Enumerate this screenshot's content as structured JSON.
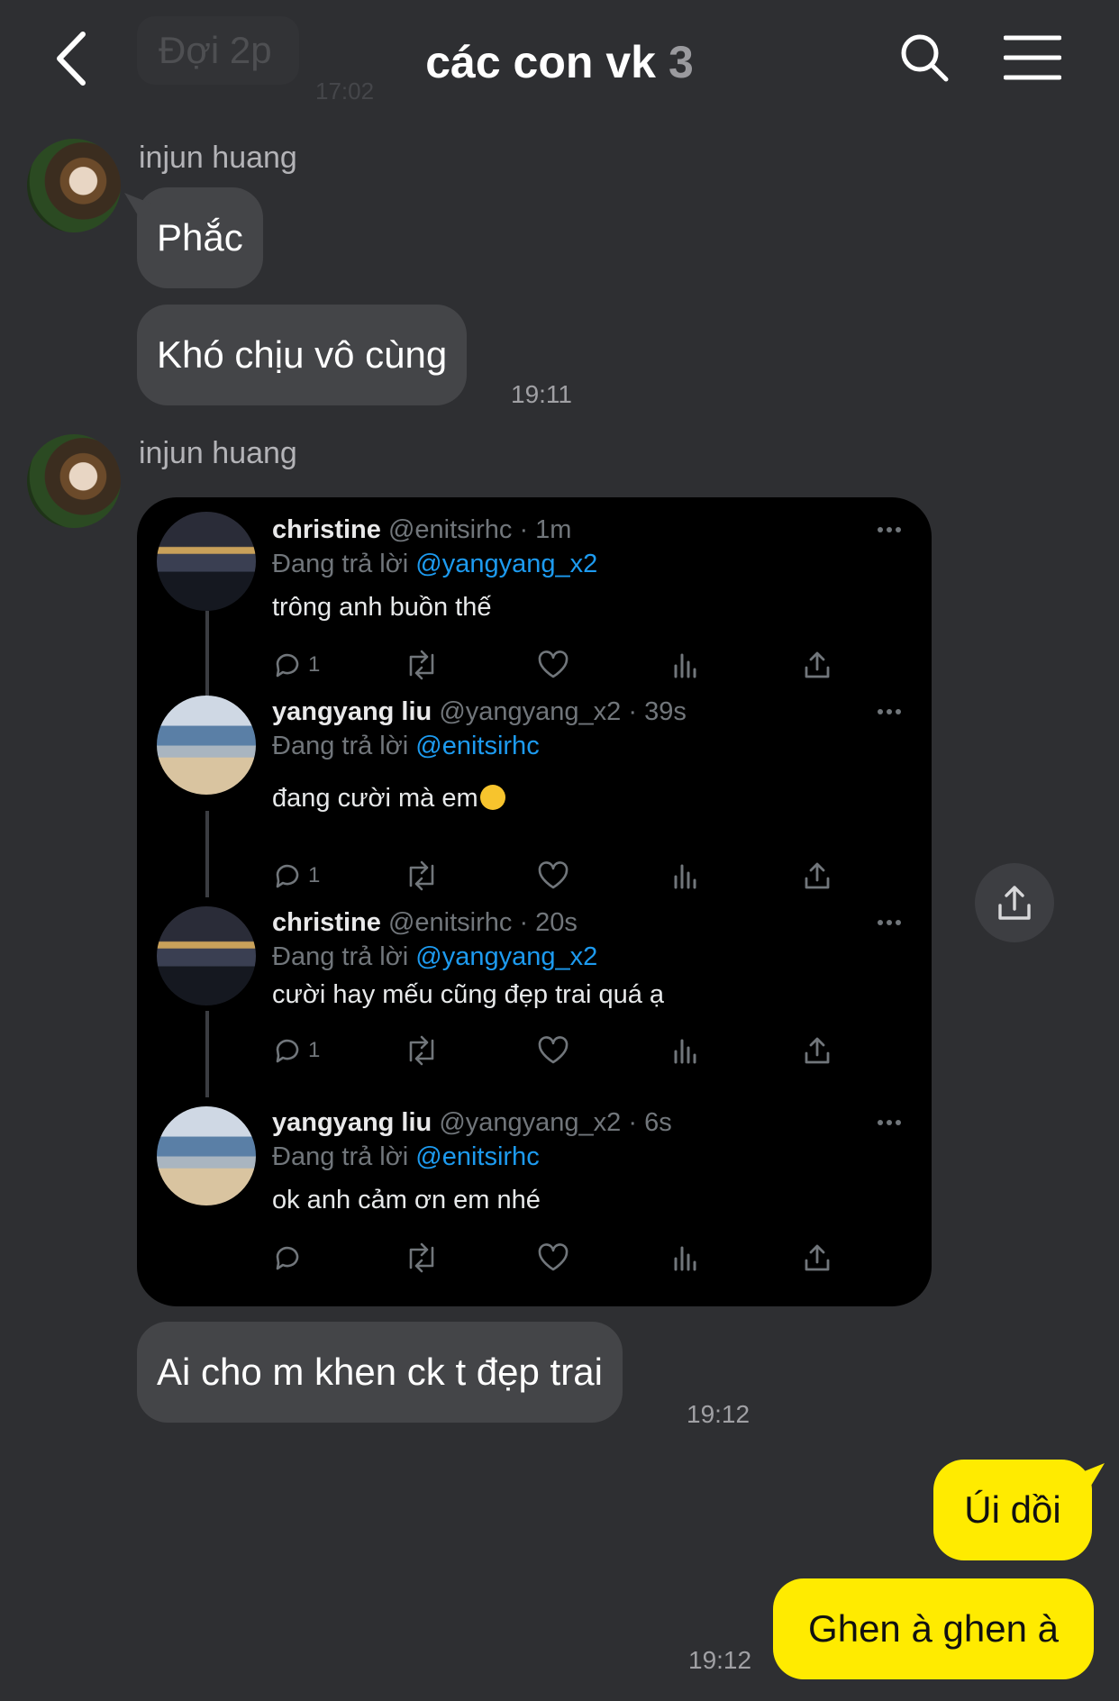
{
  "background_peek": {
    "message": "Đợi 2p",
    "time": "17:02"
  },
  "header": {
    "title": "các con vk",
    "member_count": "3"
  },
  "messages": [
    {
      "sender": "injun huang",
      "bubbles": [
        "Phắc",
        "Khó chịu vô cùng"
      ],
      "time": "19:11"
    },
    {
      "sender": "injun huang",
      "type": "image"
    },
    {
      "bubbles": [
        "Ai cho m khen ck t đẹp trai"
      ],
      "time": "19:12"
    }
  ],
  "my_messages": {
    "bubbles": [
      "Úi dồi",
      "Ghen à ghen à"
    ],
    "time": "19:12"
  },
  "screenshot_tweets": [
    {
      "name": "christine",
      "handle": "@enitsirhc",
      "age": "· 1m",
      "reply_prefix": "Đang trả lời",
      "reply_to": "@yangyang_x2",
      "text": "trông anh buồn thế",
      "reply_count": "1"
    },
    {
      "name": "yangyang liu",
      "handle": "@yangyang_x2",
      "age": "· 39s",
      "reply_prefix": "Đang trả lời",
      "reply_to": "@enitsirhc",
      "text": "đang cười mà em",
      "reply_count": "1"
    },
    {
      "name": "christine",
      "handle": "@enitsirhc",
      "age": "· 20s",
      "reply_prefix": "Đang trả lời",
      "reply_to": "@yangyang_x2",
      "text": "cười hay mếu cũng đẹp trai quá ạ",
      "reply_count": "1"
    },
    {
      "name": "yangyang liu",
      "handle": "@yangyang_x2",
      "age": "· 6s",
      "reply_prefix": "Đang trả lời",
      "reply_to": "@enitsirhc",
      "text": "ok anh cảm ơn em nhé",
      "reply_count": ""
    }
  ],
  "icons": [
    "back-arrow-icon",
    "search-icon",
    "menu-icon",
    "share-icon",
    "reply-icon",
    "retweet-icon",
    "like-icon",
    "views-icon",
    "tweet-share-icon",
    "more-icon"
  ],
  "colors": {
    "background": "#2e2f32",
    "their_bubble": "#444548",
    "my_bubble": "#ffeb00",
    "mention": "#1d9bf0"
  }
}
